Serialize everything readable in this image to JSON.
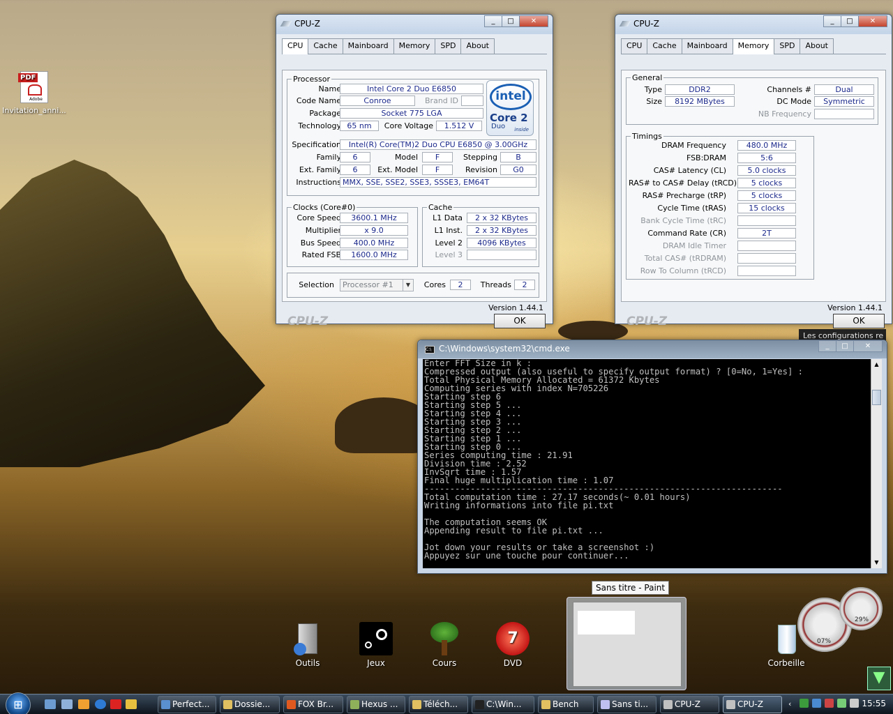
{
  "desktop": {
    "icons": [
      {
        "label": "Invitation_anni...",
        "type": "pdf"
      },
      {
        "label": "Outils"
      },
      {
        "label": "Jeux"
      },
      {
        "label": "Cours"
      },
      {
        "label": "DVD"
      },
      {
        "label": "Corbeille"
      }
    ],
    "pdf_badge": "PDF",
    "adobe_text": "Adobe",
    "partial_window_text": "Les configurations re",
    "paint_tooltip": "Sans titre - Paint"
  },
  "cpuz_cpu": {
    "title": "CPU-Z",
    "tabs": [
      "CPU",
      "Cache",
      "Mainboard",
      "Memory",
      "SPD",
      "About"
    ],
    "active_tab": "CPU",
    "processor_legend": "Processor",
    "labels": {
      "name": "Name",
      "code_name": "Code Name",
      "brand_id": "Brand ID",
      "package": "Package",
      "technology": "Technology",
      "core_voltage": "Core Voltage",
      "specification": "Specification",
      "family": "Family",
      "model": "Model",
      "stepping": "Stepping",
      "ext_family": "Ext. Family",
      "ext_model": "Ext. Model",
      "revision": "Revision",
      "instructions": "Instructions",
      "clocks_legend": "Clocks (Core#0)",
      "core_speed": "Core Speed",
      "multiplier": "Multiplier",
      "bus_speed": "Bus Speed",
      "rated_fsb": "Rated FSB",
      "cache_legend": "Cache",
      "l1_data": "L1 Data",
      "l1_inst": "L1 Inst.",
      "level2": "Level 2",
      "level3": "Level 3",
      "selection": "Selection",
      "cores": "Cores",
      "threads": "Threads"
    },
    "values": {
      "name": "Intel Core 2 Duo E6850",
      "code_name": "Conroe",
      "brand_id": "",
      "package": "Socket 775 LGA",
      "technology": "65 nm",
      "core_voltage": "1.512 V",
      "specification": "Intel(R) Core(TM)2 Duo CPU     E6850  @ 3.00GHz",
      "family": "6",
      "model": "F",
      "stepping": "B",
      "ext_family": "6",
      "ext_model": "F",
      "revision": "G0",
      "instructions": "MMX, SSE, SSE2, SSE3, SSSE3, EM64T",
      "core_speed": "3600.1 MHz",
      "multiplier": "x 9.0",
      "bus_speed": "400.0 MHz",
      "rated_fsb": "1600.0 MHz",
      "l1_data": "2 x 32 KBytes",
      "l1_inst": "2 x 32 KBytes",
      "level2": "4096 KBytes",
      "level3": "",
      "selection": "Processor #1",
      "cores": "2",
      "threads": "2"
    },
    "intel_logo": {
      "brand": "intel",
      "line": "Core 2",
      "sub": "Duo",
      "inside": "inside"
    },
    "version": "Version 1.44.1",
    "brand": "CPU-Z",
    "ok": "OK"
  },
  "cpuz_mem": {
    "title": "CPU-Z",
    "tabs": [
      "CPU",
      "Cache",
      "Mainboard",
      "Memory",
      "SPD",
      "About"
    ],
    "active_tab": "Memory",
    "general_legend": "General",
    "timings_legend": "Timings",
    "general": {
      "type_label": "Type",
      "type": "DDR2",
      "size_label": "Size",
      "size": "8192 MBytes",
      "channels_label": "Channels #",
      "channels": "Dual",
      "dcmode_label": "DC Mode",
      "dcmode": "Symmetric",
      "nbfreq_label": "NB Frequency",
      "nbfreq": ""
    },
    "timings": [
      {
        "label": "DRAM Frequency",
        "value": "480.0 MHz",
        "dim": false
      },
      {
        "label": "FSB:DRAM",
        "value": "5:6",
        "dim": false
      },
      {
        "label": "CAS# Latency (CL)",
        "value": "5.0 clocks",
        "dim": false
      },
      {
        "label": "RAS# to CAS# Delay (tRCD)",
        "value": "5 clocks",
        "dim": false
      },
      {
        "label": "RAS# Precharge (tRP)",
        "value": "5 clocks",
        "dim": false
      },
      {
        "label": "Cycle Time (tRAS)",
        "value": "15 clocks",
        "dim": false
      },
      {
        "label": "Bank Cycle Time (tRC)",
        "value": "",
        "dim": true
      },
      {
        "label": "Command Rate (CR)",
        "value": "2T",
        "dim": false
      },
      {
        "label": "DRAM Idle Timer",
        "value": "",
        "dim": true
      },
      {
        "label": "Total CAS# (tRDRAM)",
        "value": "",
        "dim": true
      },
      {
        "label": "Row To Column (tRCD)",
        "value": "",
        "dim": true
      }
    ],
    "version": "Version 1.44.1",
    "brand": "CPU-Z",
    "ok": "OK"
  },
  "cmd": {
    "title": "C:\\Windows\\system32\\cmd.exe",
    "lines": [
      "Enter FFT Size in k :",
      "Compressed output (also useful to specify output format) ? [0=No, 1=Yes] :",
      "Total Physical Memory Allocated = 61372 Kbytes",
      "Computing series with index N=705226",
      "Starting step 6",
      "Starting step 5 ...",
      "Starting step 4 ...",
      "Starting step 3 ...",
      "Starting step 2 ...",
      "Starting step 1 ...",
      "Starting step 0 ...",
      "Series computing time : 21.91",
      "Division time : 2.52",
      "InvSqrt time : 1.57",
      "Final huge multiplication time : 1.07",
      "----------------------------------------------------------------------",
      "Total computation time : 27.17 seconds(~ 0.01 hours)",
      "Writing informations into file pi.txt",
      "",
      "The computation seems OK",
      "Appending result to file pi.txt ...",
      "",
      "Jot down your results or take a screenshot :)",
      "Appuyez sur une touche pour continuer..."
    ]
  },
  "gadgets": {
    "cpu": "07%",
    "mem": "29%"
  },
  "taskbar": {
    "buttons": [
      "Perfect...",
      "Dossie...",
      "FOX Br...",
      "Hexus ...",
      "Téléch...",
      "C:\\Win...",
      "Bench",
      "Sans ti...",
      "CPU-Z",
      "CPU-Z"
    ],
    "clock": "15:55"
  }
}
